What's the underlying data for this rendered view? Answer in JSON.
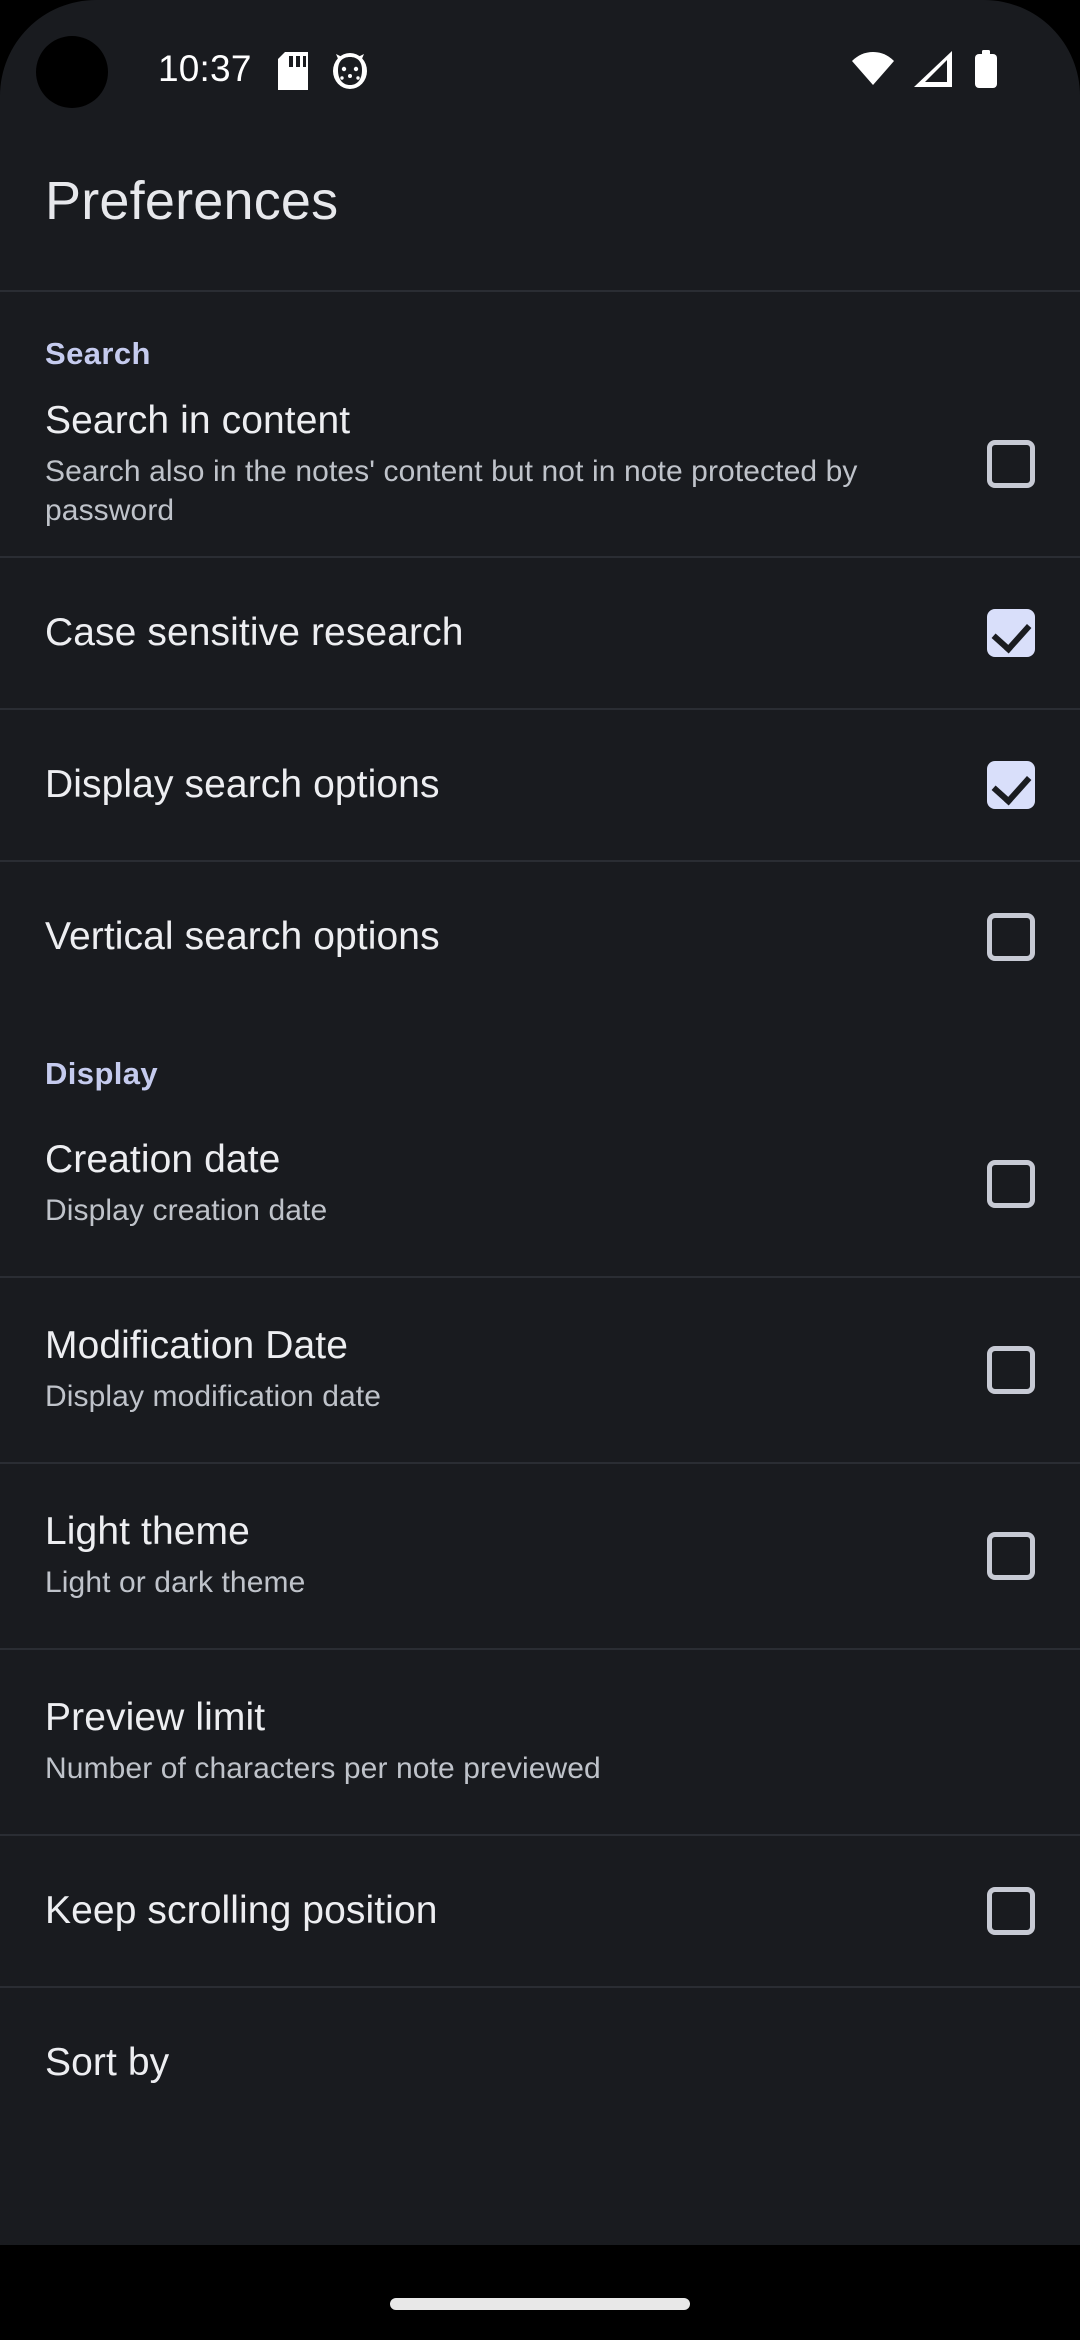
{
  "status_bar": {
    "time": "10:37",
    "left_icons": [
      {
        "name": "sd-card-icon"
      },
      {
        "name": "app-notification-icon"
      }
    ],
    "right_icons": [
      {
        "name": "wifi-icon"
      },
      {
        "name": "cellular-signal-icon"
      },
      {
        "name": "battery-icon"
      }
    ]
  },
  "header": {
    "title": "Preferences"
  },
  "sections": [
    {
      "label": "Search",
      "items": [
        {
          "title": "Search in content",
          "summary": "Search also in the notes' content but not in note protected by password",
          "checked": false
        },
        {
          "title": "Case sensitive research",
          "summary": "",
          "checked": true
        },
        {
          "title": "Display search options",
          "summary": "",
          "checked": true
        },
        {
          "title": "Vertical search options",
          "summary": "",
          "checked": false
        }
      ]
    },
    {
      "label": "Display",
      "items": [
        {
          "title": "Creation date",
          "summary": "Display creation date",
          "checked": false
        },
        {
          "title": "Modification Date",
          "summary": "Display modification date",
          "checked": false
        },
        {
          "title": "Light theme",
          "summary": "Light or dark theme",
          "checked": false
        },
        {
          "title": "Preview limit",
          "summary": "Number of characters per note previewed",
          "checked": null
        },
        {
          "title": "Keep scrolling position",
          "summary": "",
          "checked": false
        },
        {
          "title": "Sort by",
          "summary": "",
          "checked": null
        }
      ]
    }
  ],
  "nav_bar": {
    "gesture_pill": "home-gesture-pill"
  },
  "colors": {
    "background": "#191B1F",
    "section_header": "#C5CBEE",
    "checkbox_checked_fill": "#D9DFFA",
    "checkbox_outline": "#C7CAD4",
    "divider": "#2A2D33",
    "title_text": "#E7E8EC",
    "summary_text": "#BFC3CA"
  }
}
